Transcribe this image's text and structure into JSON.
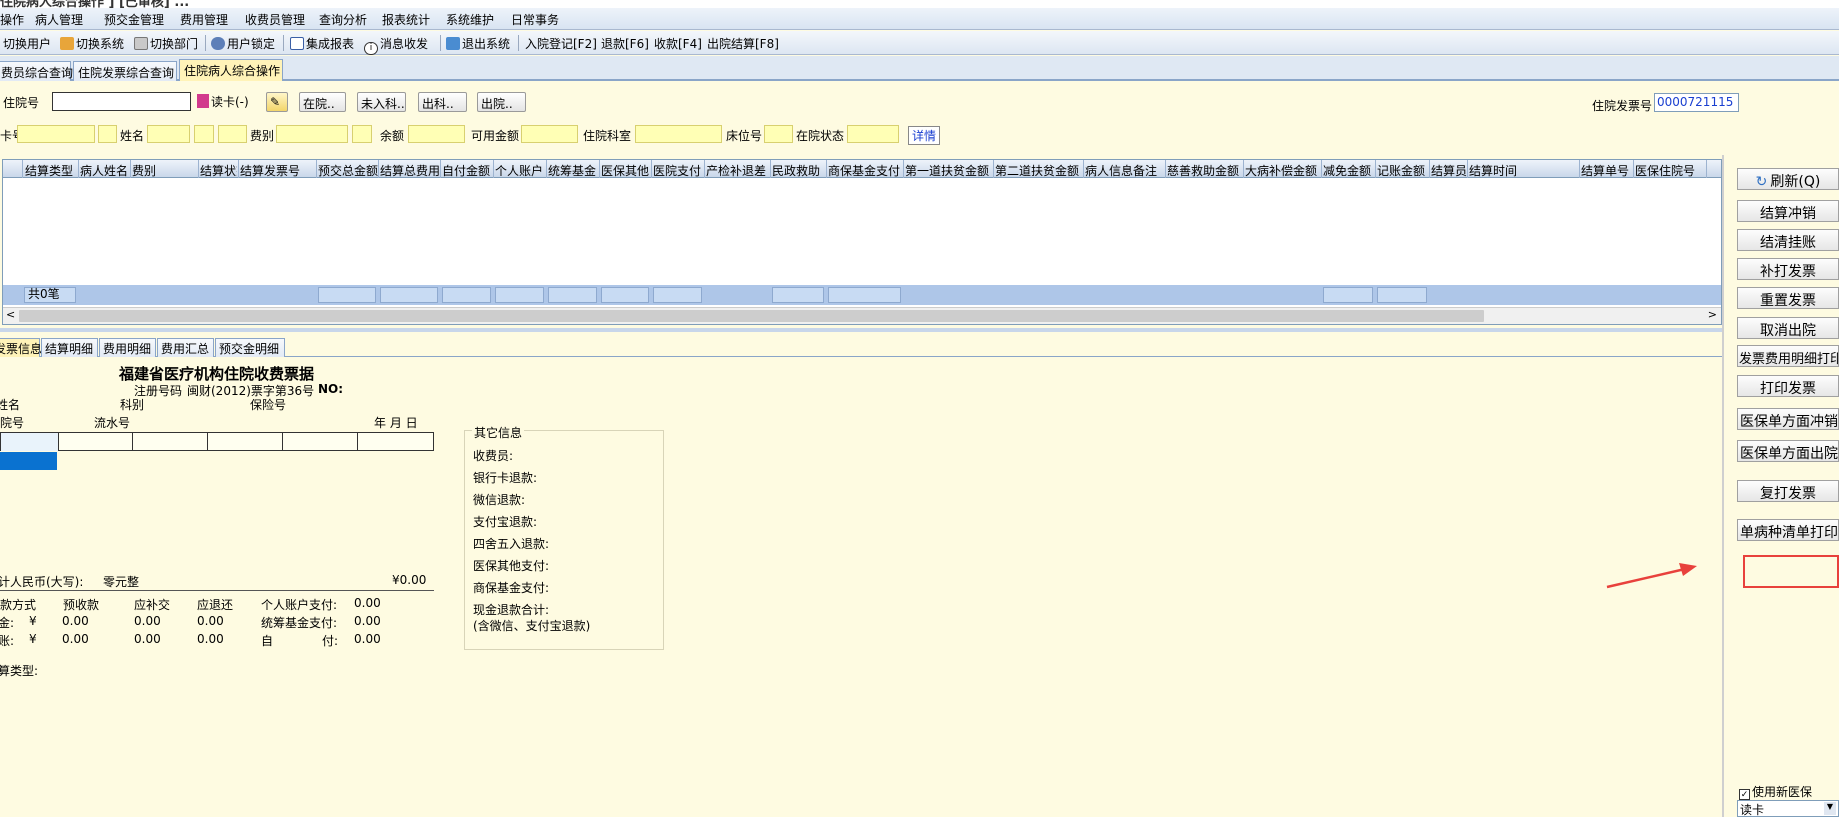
{
  "title": "住院病人综合操作 ] [已审核] ...",
  "menu": [
    "操作",
    "病人管理",
    "预交金管理",
    "费用管理",
    "收费员管理",
    "查询分析",
    "报表统计",
    "系统维护",
    "日常事务"
  ],
  "toolbar": {
    "switch_user": "切换用户",
    "switch_system": "切换系统",
    "switch_dept": "切换部门",
    "user_lock": "用户锁定",
    "integrated_report": "集成报表",
    "messages": "消息收发",
    "exit": "退出系统",
    "admit": "入院登记[F2]",
    "refund": "退款[F6]",
    "charge": "收款[F4]",
    "discharge": "出院结算[F8]"
  },
  "tabs": [
    "费员综合查询",
    "住院发票综合查询",
    "住院病人综合操作"
  ],
  "search": {
    "hosp_no_label": "住院号",
    "hosp_no_value": "",
    "read_card": "读卡(-)",
    "in_hosp": "在院..",
    "not_admitted": "未入科..",
    "out_dept": "出科..",
    "discharged": "出院..",
    "invoice_no_label": "住院发票号",
    "invoice_no_value": "0000721115"
  },
  "info": {
    "card_label": "卡号",
    "name_label": "姓名",
    "fee_type_label": "费别",
    "balance_label": "余额",
    "available_label": "可用金额",
    "ward_label": "住院科室",
    "bed_label": "床位号",
    "status_label": "在院状态",
    "detail": "详情"
  },
  "grid": {
    "columns": [
      "结算类型",
      "病人姓名",
      "费别",
      "结算状态",
      "结算发票号",
      "预交总金额",
      "结算总费用",
      "自付金额",
      "个人账户",
      "统筹基金",
      "医保其他",
      "医院支付",
      "产检补退差",
      "民政救助",
      "商保基金支付",
      "第一道扶贫金额",
      "第二道扶贫金额",
      "病人信息备注",
      "慈善救助金额",
      "大病补偿金额",
      "减免金额",
      "记账金额",
      "结算员",
      "结算时间",
      "结算单号",
      "医保住院号"
    ],
    "footer_count": "共0笔"
  },
  "bottom_tabs": [
    "发票信息",
    "结算明细",
    "费用明细",
    "费用汇总",
    "预交金明细"
  ],
  "receipt": {
    "title": "福建省医疗机构住院收费票据",
    "reg_label": "注册号码",
    "reg_value": "闽财(2012)票字第36号",
    "no_label": "NO:",
    "name": "姓名",
    "dept": "科别",
    "insurance_no": "保险号",
    "hosp_no": "住院号",
    "serial_no": "流水号",
    "date": "年  月  日",
    "total_label": "合计人民币(大写):",
    "total_words": "零元整",
    "total_amount": "¥0.00",
    "pay_method": "付款方式",
    "prepaid": "预收款",
    "supplement": "应补交",
    "to_refund": "应退还",
    "personal_acct": "个人账户支付:",
    "personal_acct_val": "0.00",
    "cash_label": "现金:",
    "yen": "¥",
    "cash_prepaid": "0.00",
    "cash_supp": "0.00",
    "cash_refund": "0.00",
    "pooled": "统筹基金支付:",
    "pooled_val": "0.00",
    "transfer_label": "转账:",
    "tr_prepaid": "0.00",
    "tr_supp": "0.00",
    "tr_refund": "0.00",
    "self_label": "自",
    "self_label2": "付:",
    "self_val": "0.00",
    "settle_type": "结算类型:"
  },
  "other": {
    "title": "其它信息",
    "cashier": "收费员:",
    "bank_refund": "银行卡退款:",
    "wechat_refund": "微信退款:",
    "alipay_refund": "支付宝退款:",
    "round_refund": "四舍五入退款:",
    "insurance_other": "医保其他支付:",
    "commercial_fund": "商保基金支付:",
    "cash_refund_total": "现金退款合计:",
    "cash_refund_note": "(含微信、支付宝退款)"
  },
  "right_buttons": {
    "refresh": "刷新(Q)",
    "settle_reverse": "结算冲销",
    "settle_clear": "结清挂账",
    "reprint_invoice": "补打发票",
    "reset_invoice": "重置发票",
    "cancel_discharge": "取消出院",
    "invoice_detail_print": "发票费用明细打印",
    "print_invoice": "打印发票",
    "ins_reverse": "医保单方面冲销",
    "ins_discharge": "医保单方面出院",
    "reprint": "复打发票",
    "single_disease_print": "单病种清单打印",
    "use_new_ins": "使用新医保",
    "card_select": "读卡"
  },
  "colors": {
    "annotation_red": "#e8413c",
    "background": "#fefbe1",
    "field": "#ffffb5"
  }
}
